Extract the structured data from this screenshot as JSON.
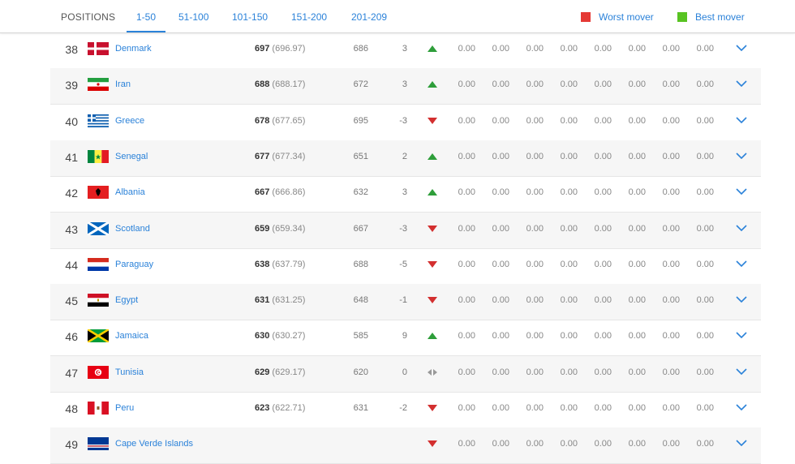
{
  "header": {
    "positions_label": "POSITIONS",
    "tabs": [
      {
        "label": "1-50",
        "active": true
      },
      {
        "label": "51-100",
        "active": false
      },
      {
        "label": "101-150",
        "active": false
      },
      {
        "label": "151-200",
        "active": false
      },
      {
        "label": "201-209",
        "active": false
      }
    ],
    "legend": {
      "worst_label": "Worst mover",
      "best_label": "Best mover",
      "worst_color": "#e53935",
      "best_color": "#58c322"
    }
  },
  "colors": {
    "accent": "#2b82d9",
    "trend_up": "#2e9e3a",
    "trend_down": "#d32f2f",
    "trend_neutral": "#999999"
  },
  "rows": [
    {
      "rank": "38",
      "flag": "denmark-flag",
      "country": "Denmark",
      "points": "697",
      "points_exact": "(696.97)",
      "previous": "686",
      "movement": "3",
      "trend": "up",
      "values": [
        "0.00",
        "0.00",
        "0.00",
        "0.00",
        "0.00",
        "0.00",
        "0.00",
        "0.00"
      ]
    },
    {
      "rank": "39",
      "flag": "iran-flag",
      "country": "Iran",
      "points": "688",
      "points_exact": "(688.17)",
      "previous": "672",
      "movement": "3",
      "trend": "up",
      "values": [
        "0.00",
        "0.00",
        "0.00",
        "0.00",
        "0.00",
        "0.00",
        "0.00",
        "0.00"
      ]
    },
    {
      "rank": "40",
      "flag": "greece-flag",
      "country": "Greece",
      "points": "678",
      "points_exact": "(677.65)",
      "previous": "695",
      "movement": "-3",
      "trend": "down",
      "values": [
        "0.00",
        "0.00",
        "0.00",
        "0.00",
        "0.00",
        "0.00",
        "0.00",
        "0.00"
      ]
    },
    {
      "rank": "41",
      "flag": "senegal-flag",
      "country": "Senegal",
      "points": "677",
      "points_exact": "(677.34)",
      "previous": "651",
      "movement": "2",
      "trend": "up",
      "values": [
        "0.00",
        "0.00",
        "0.00",
        "0.00",
        "0.00",
        "0.00",
        "0.00",
        "0.00"
      ]
    },
    {
      "rank": "42",
      "flag": "albania-flag",
      "country": "Albania",
      "points": "667",
      "points_exact": "(666.86)",
      "previous": "632",
      "movement": "3",
      "trend": "up",
      "values": [
        "0.00",
        "0.00",
        "0.00",
        "0.00",
        "0.00",
        "0.00",
        "0.00",
        "0.00"
      ]
    },
    {
      "rank": "43",
      "flag": "scotland-flag",
      "country": "Scotland",
      "points": "659",
      "points_exact": "(659.34)",
      "previous": "667",
      "movement": "-3",
      "trend": "down",
      "values": [
        "0.00",
        "0.00",
        "0.00",
        "0.00",
        "0.00",
        "0.00",
        "0.00",
        "0.00"
      ]
    },
    {
      "rank": "44",
      "flag": "paraguay-flag",
      "country": "Paraguay",
      "points": "638",
      "points_exact": "(637.79)",
      "previous": "688",
      "movement": "-5",
      "trend": "down",
      "values": [
        "0.00",
        "0.00",
        "0.00",
        "0.00",
        "0.00",
        "0.00",
        "0.00",
        "0.00"
      ]
    },
    {
      "rank": "45",
      "flag": "egypt-flag",
      "country": "Egypt",
      "points": "631",
      "points_exact": "(631.25)",
      "previous": "648",
      "movement": "-1",
      "trend": "down",
      "values": [
        "0.00",
        "0.00",
        "0.00",
        "0.00",
        "0.00",
        "0.00",
        "0.00",
        "0.00"
      ]
    },
    {
      "rank": "46",
      "flag": "jamaica-flag",
      "country": "Jamaica",
      "points": "630",
      "points_exact": "(630.27)",
      "previous": "585",
      "movement": "9",
      "trend": "up",
      "values": [
        "0.00",
        "0.00",
        "0.00",
        "0.00",
        "0.00",
        "0.00",
        "0.00",
        "0.00"
      ]
    },
    {
      "rank": "47",
      "flag": "tunisia-flag",
      "country": "Tunisia",
      "points": "629",
      "points_exact": "(629.17)",
      "previous": "620",
      "movement": "0",
      "trend": "neutral",
      "values": [
        "0.00",
        "0.00",
        "0.00",
        "0.00",
        "0.00",
        "0.00",
        "0.00",
        "0.00"
      ]
    },
    {
      "rank": "48",
      "flag": "peru-flag",
      "country": "Peru",
      "points": "623",
      "points_exact": "(622.71)",
      "previous": "631",
      "movement": "-2",
      "trend": "down",
      "values": [
        "0.00",
        "0.00",
        "0.00",
        "0.00",
        "0.00",
        "0.00",
        "0.00",
        "0.00"
      ]
    },
    {
      "rank": "49",
      "flag": "cape-verde-flag",
      "country": "Cape Verde Islands",
      "points": "",
      "points_exact": "",
      "previous": "",
      "movement": "",
      "trend": "down",
      "values": [
        "0.00",
        "0.00",
        "0.00",
        "0.00",
        "0.00",
        "0.00",
        "0.00",
        "0.00"
      ]
    }
  ]
}
